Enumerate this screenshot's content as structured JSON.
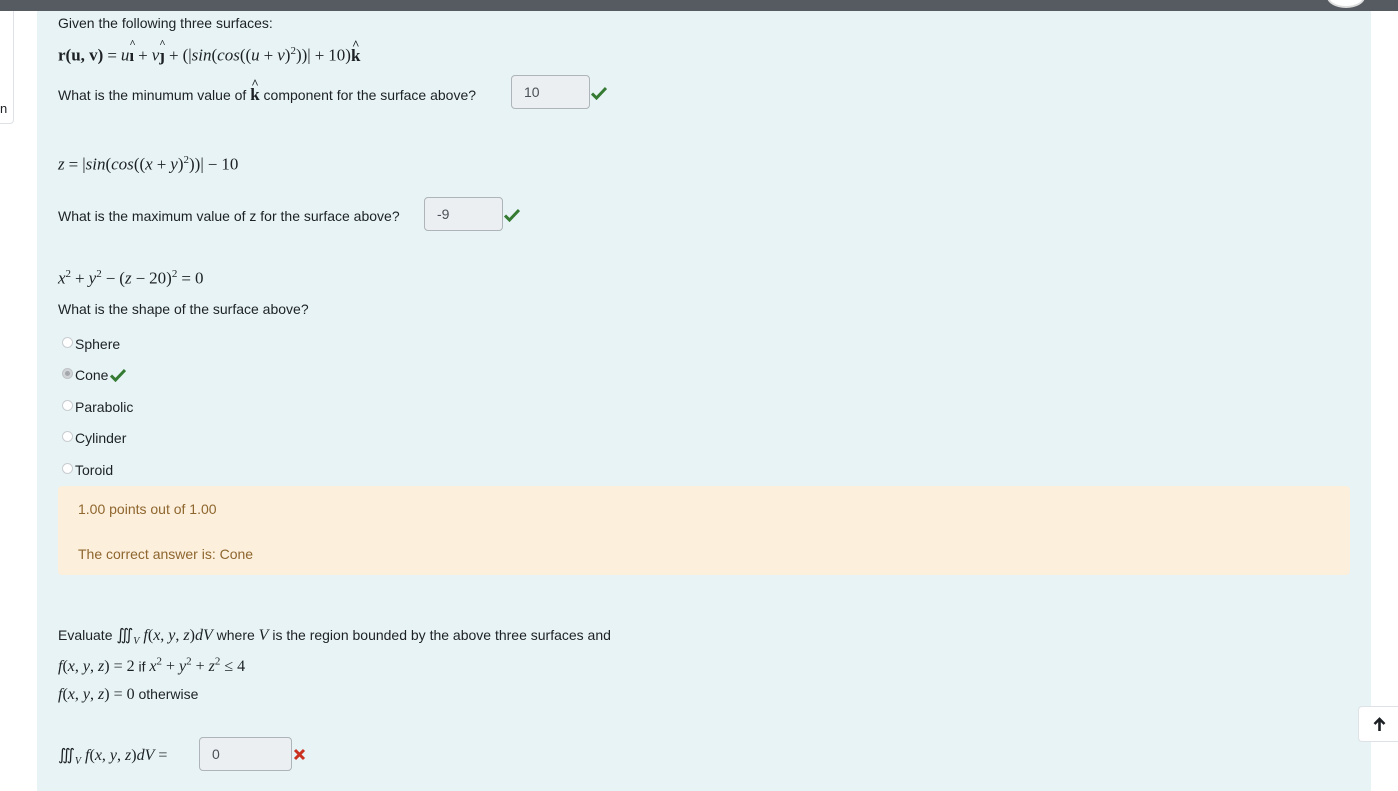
{
  "sidebar": {
    "partial_text": "n"
  },
  "q1": {
    "intro": "Given the following three surfaces:",
    "surface1": "r(u, v) = uî + vĵ + (|sin(cos((u + v)²))| + 10)k̂",
    "question_before": "What is the minumum value of",
    "question_k": "k",
    "question_after": "component for the surface above?",
    "answer": "10"
  },
  "q2": {
    "surface2": "z = |sin(cos((x + y)²))| − 10",
    "question": "What is the maximum value of z for the surface above?",
    "answer": "-9"
  },
  "q3": {
    "surface3": "x² + y² − (z − 20)² = 0",
    "question": "What is the shape of the surface above?",
    "options": [
      "Sphere",
      "Cone",
      "Parabolic",
      "Cylinder",
      "Toroid"
    ],
    "selected": "Cone"
  },
  "feedback": {
    "points": "1.00 points out of 1.00",
    "correct_answer": "The correct answer is: Cone"
  },
  "q4": {
    "evaluate_word": "Evaluate",
    "integral_expr": "∭ᵥ f(x, y, z)dV",
    "where_text_1": "where",
    "v_symbol": "V",
    "where_text_2": "is the region bounded by the above three surfaces and",
    "f_def_1_lhs": "f(x, y, z) = 2",
    "f_def_1_if": "if",
    "f_def_1_cond": "x² + y² + z² ≤ 4",
    "f_def_2_lhs": "f(x, y, z) = 0",
    "f_def_2_text": "otherwise",
    "answer_label": "∭ᵥ f(x, y, z)dV =",
    "answer": "0"
  },
  "colors": {
    "correct": "#357a32",
    "incorrect": "#ca3120",
    "panel": "#e7f3f5",
    "feedback_bg": "#fcefdc",
    "feedback_text": "#8e662e"
  },
  "icons": {
    "check": "check-icon",
    "cross": "cross-icon",
    "back_to_top": "arrow-up-icon"
  }
}
